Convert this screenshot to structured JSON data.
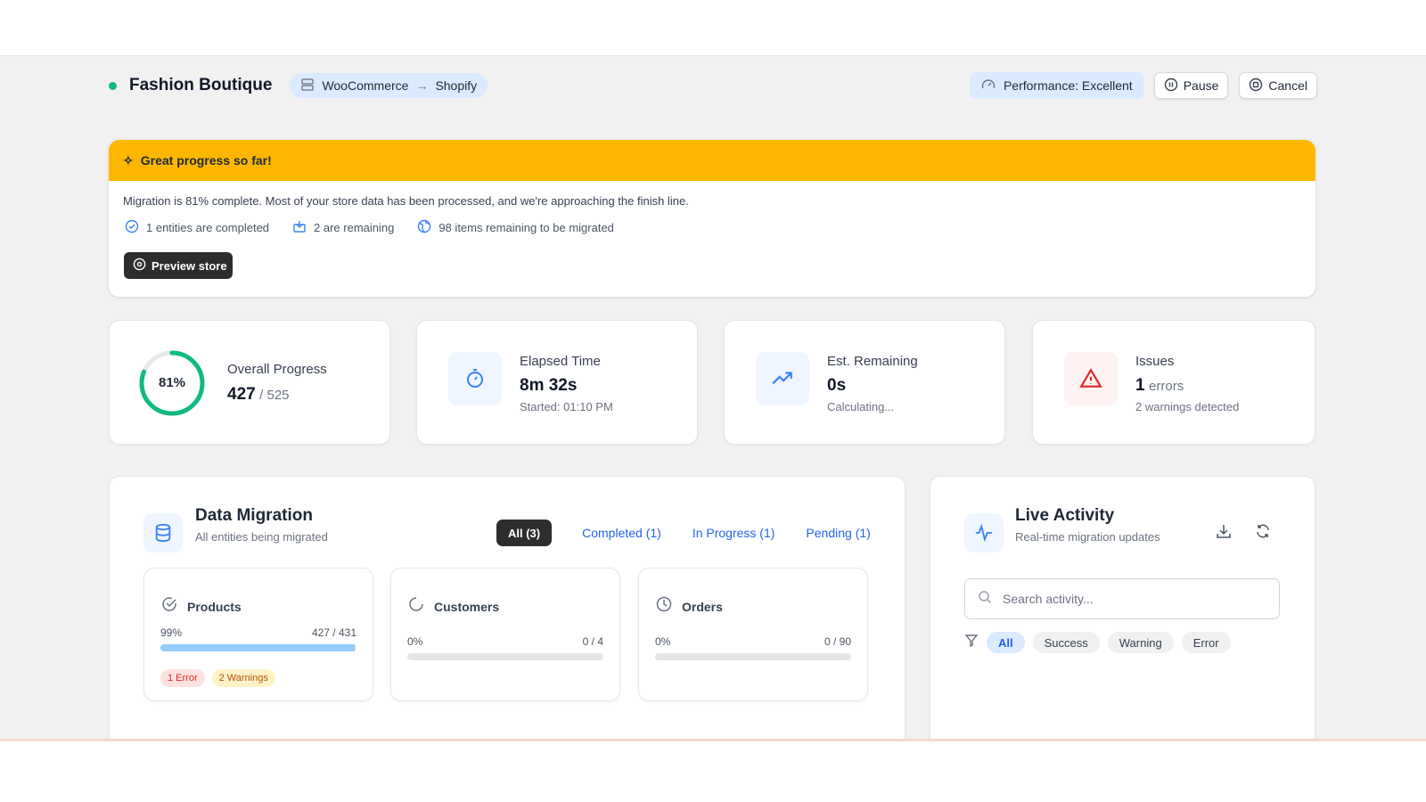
{
  "header": {
    "store_name": "Fashion Boutique",
    "source": "WooCommerce",
    "target": "Shopify",
    "performance": "Performance: Excellent",
    "pause": "Pause",
    "cancel": "Cancel"
  },
  "banner": {
    "title": "Great progress so far!",
    "message": "Migration is 81% complete. Most of your store data has been processed, and we're approaching the finish line.",
    "completed": "1 entities are completed",
    "remaining": "2 are remaining",
    "items_remaining": "98 items remaining to be migrated",
    "preview": "Preview store"
  },
  "stats": {
    "overall": {
      "label": "Overall Progress",
      "percent_text": "81%",
      "percent": 81,
      "value": "427",
      "total": "/ 525"
    },
    "elapsed": {
      "label": "Elapsed Time",
      "value": "8m 32s",
      "sub": "Started: 01:10 PM"
    },
    "remaining": {
      "label": "Est. Remaining",
      "value": "0s",
      "sub": "Calculating..."
    },
    "issues": {
      "label": "Issues",
      "value": "1",
      "unit": "errors",
      "sub": "2 warnings detected"
    }
  },
  "migration": {
    "title": "Data Migration",
    "subtitle": "All entities being migrated",
    "tabs": [
      "All (3)",
      "Completed (1)",
      "In Progress (1)",
      "Pending (1)"
    ],
    "entities": [
      {
        "name": "Products",
        "percent_text": "99%",
        "count": "427 / 431",
        "progress": 99,
        "error": "1 Error",
        "warnings": "2 Warnings"
      },
      {
        "name": "Customers",
        "percent_text": "0%",
        "count": "0 / 4",
        "progress": 0
      },
      {
        "name": "Orders",
        "percent_text": "0%",
        "count": "0 / 90",
        "progress": 0
      }
    ]
  },
  "activity": {
    "title": "Live Activity",
    "subtitle": "Real-time migration updates",
    "search_placeholder": "Search activity...",
    "filters": [
      "All",
      "Success",
      "Warning",
      "Error"
    ]
  },
  "colors": {
    "accent": "#2563eb",
    "banner": "#fdb700",
    "success": "#10b981",
    "error": "#dc2626"
  }
}
